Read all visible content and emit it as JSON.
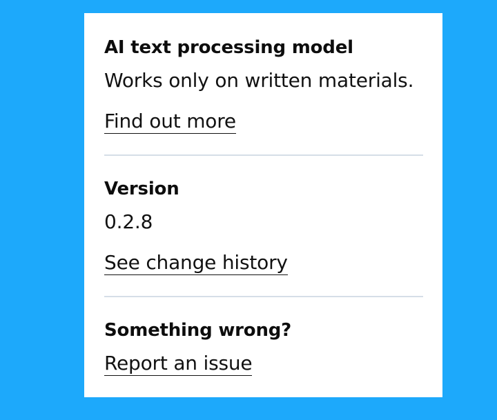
{
  "model_section": {
    "title": "AI text processing model",
    "description": "Works only on written materials.",
    "link_label": "Find out more"
  },
  "version_section": {
    "title": "Version",
    "value": "0.2.8",
    "link_label": "See change history"
  },
  "issue_section": {
    "title": "Something wrong?",
    "link_label": "Report an issue"
  },
  "colors": {
    "background": "#1da9fb",
    "card": "#ffffff",
    "divider": "#d5dee7",
    "text": "#111111"
  }
}
